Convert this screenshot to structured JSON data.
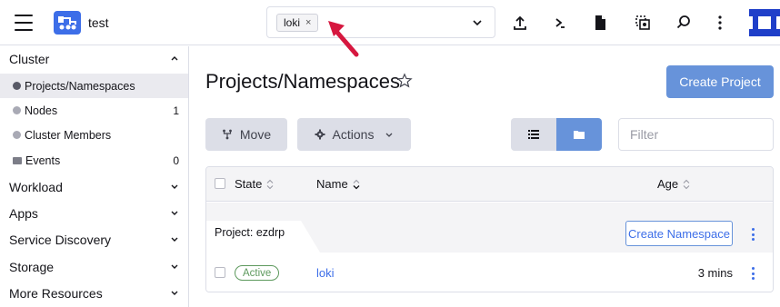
{
  "header": {
    "cluster_name": "test",
    "namespace_chip": "loki",
    "namespace_chip_remove": "×"
  },
  "sidebar": {
    "groups": [
      {
        "label": "Cluster",
        "expanded": true
      },
      {
        "label": "Workload",
        "expanded": false
      },
      {
        "label": "Apps",
        "expanded": false
      },
      {
        "label": "Service Discovery",
        "expanded": false
      },
      {
        "label": "Storage",
        "expanded": false
      },
      {
        "label": "More Resources",
        "expanded": false
      }
    ],
    "cluster_items": [
      {
        "label": "Projects/Namespaces",
        "count": "",
        "icon": "dot-icon",
        "active": true
      },
      {
        "label": "Nodes",
        "count": "1",
        "icon": "dot-icon"
      },
      {
        "label": "Cluster Members",
        "count": "",
        "icon": "dot-icon"
      },
      {
        "label": "Events",
        "count": "0",
        "icon": "folder-icon"
      }
    ]
  },
  "main": {
    "title": "Projects/Namespaces",
    "create_project": "Create Project",
    "move": "Move",
    "actions": "Actions",
    "filter_placeholder": "Filter"
  },
  "table": {
    "columns": [
      "State",
      "Name",
      "Age"
    ],
    "group_label": "Project: ezdrp",
    "create_namespace": "Create Namespace",
    "rows": [
      {
        "state": "Active",
        "name": "loki",
        "age": "3 mins"
      }
    ]
  },
  "colors": {
    "primary": "#6793da",
    "link": "#3d6ee8",
    "active_state": "#5d995d",
    "arrow": "#d6173f"
  }
}
